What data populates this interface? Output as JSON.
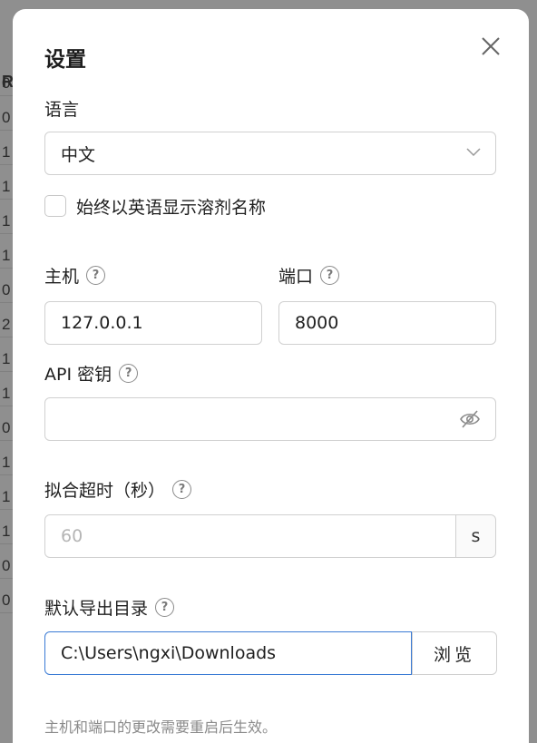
{
  "backdrop": {
    "header": "R",
    "cells": [
      "0",
      "0",
      "1",
      "1",
      "1",
      "1",
      "0",
      "2",
      "1",
      "1",
      "0",
      "1",
      "1",
      "1",
      "0",
      "0"
    ]
  },
  "dialog": {
    "title": "设置",
    "language": {
      "label": "语言",
      "selected": "中文"
    },
    "english_solvent_names": {
      "label": "始终以英语显示溶剂名称",
      "checked": false
    },
    "host": {
      "label": "主机",
      "value": "127.0.0.1"
    },
    "port": {
      "label": "端口",
      "value": "8000"
    },
    "api_key": {
      "label": "API 密钥",
      "value": ""
    },
    "fit_timeout": {
      "label": "拟合超时（秒）",
      "placeholder": "60",
      "unit": "s"
    },
    "export_dir": {
      "label": "默认导出目录",
      "value": "C:\\Users\\ngxi\\Downloads",
      "browse_label": "浏览"
    },
    "footer_note": "主机和端口的更改需要重启后生效。"
  },
  "colors": {
    "accent": "#3a7bd5",
    "overlay": "#8f8f8f"
  }
}
